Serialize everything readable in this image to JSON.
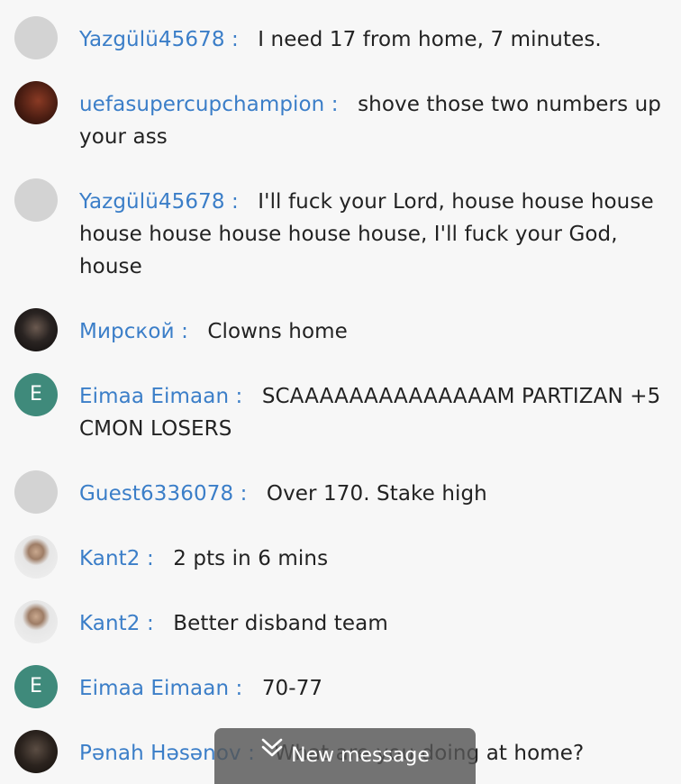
{
  "colors": {
    "background": "#f7f7f7",
    "username": "#3b7ec8",
    "message_text": "#222222",
    "letter_avatar": "#3f8a7b",
    "blank_avatar": "#d3d3d3",
    "new_message_button": "#555555"
  },
  "messages": [
    {
      "username": "Yazgülü45678",
      "separator": ":",
      "text": "I need 17 from home, 7 minutes.",
      "avatar": "blank"
    },
    {
      "username": "uefasupercupchampion",
      "separator": ":",
      "text": "shove those two numbers up your ass",
      "avatar": "photo"
    },
    {
      "username": "Yazgülü45678",
      "separator": ":",
      "text": "I'll fuck your Lord, house house house house house house house house, I'll fuck your God, house",
      "avatar": "blank"
    },
    {
      "username": "Мирской",
      "separator": ":",
      "text": "Clowns home",
      "avatar": "photo"
    },
    {
      "username": "Eimaa Eimaan",
      "separator": ":",
      "text": "SCAAAAAAAAAAAAAAM PARTIZAN +5 CMON LOSERS",
      "avatar": "letter",
      "avatar_letter": "E"
    },
    {
      "username": "Guest6336078",
      "separator": ":",
      "text": "Over 170. Stake high",
      "avatar": "blank"
    },
    {
      "username": "Kant2",
      "separator": ":",
      "text": "2 pts in 6 mins",
      "avatar": "photo"
    },
    {
      "username": "Kant2",
      "separator": ":",
      "text": "Better disband team",
      "avatar": "photo"
    },
    {
      "username": "Eimaa Eimaan",
      "separator": ":",
      "text": "70-77",
      "avatar": "letter",
      "avatar_letter": "E"
    },
    {
      "username": "Pənah Həsənov",
      "separator": ":",
      "text": "What are you doing at home?",
      "avatar": "photo"
    }
  ],
  "new_message_button": {
    "label": "New message",
    "icon": "double-chevron-down-icon"
  }
}
